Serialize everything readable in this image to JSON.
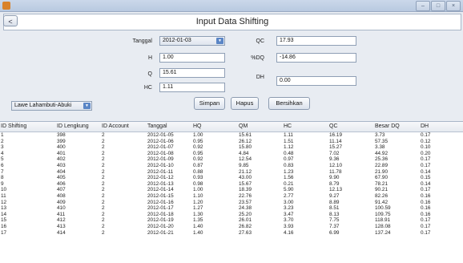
{
  "window": {
    "minimize": "–",
    "maximize": "□",
    "close": "×"
  },
  "header": {
    "back_label": "<",
    "title": "Input Data Shifting"
  },
  "form": {
    "tanggal_label": "Tanggal",
    "tanggal_value": "2012-01-03",
    "h_label": "H",
    "h_value": "1.00",
    "q_label": "Q",
    "q_value": "15.61",
    "hc_label": "HC",
    "hc_value": "1.11",
    "qc_label": "QC",
    "qc_value": "17.93",
    "dq_label": "%DQ",
    "dq_value": "-14.86",
    "dh_label": "DH",
    "dh_value": "0.00"
  },
  "station_select": {
    "value": "Lawe Lahambuti-Abuki"
  },
  "buttons": {
    "simpan": "Simpan",
    "hapus": "Hapus",
    "bersihkan": "Bersihkan"
  },
  "table": {
    "columns": [
      "ID Shifting",
      "ID Lengkung",
      "ID Account",
      "Tanggal",
      "HQ",
      "QM",
      "HC",
      "QC",
      "Besar DQ",
      "DH"
    ],
    "rows": [
      [
        "1",
        "398",
        "2",
        "2012-01-05",
        "1.00",
        "15.61",
        "1.11",
        "16.19",
        "3.73",
        "0.17"
      ],
      [
        "2",
        "399",
        "2",
        "2012-01-06",
        "0.95",
        "26.12",
        "1.51",
        "11.14",
        "57.35",
        "0.12"
      ],
      [
        "3",
        "400",
        "2",
        "2012-01-07",
        "0.92",
        "15.80",
        "1.12",
        "15.27",
        "3.38",
        "0.10"
      ],
      [
        "4",
        "401",
        "2",
        "2012-01-08",
        "0.95",
        "4.84",
        "0.48",
        "7.02",
        "44.92",
        "0.20"
      ],
      [
        "5",
        "402",
        "2",
        "2012-01-09",
        "0.92",
        "12.54",
        "0.97",
        "9.36",
        "25.36",
        "0.17"
      ],
      [
        "6",
        "403",
        "2",
        "2012-01-10",
        "0.87",
        "9.85",
        "0.83",
        "12.10",
        "22.89",
        "0.17"
      ],
      [
        "7",
        "404",
        "2",
        "2012-01-11",
        "0.88",
        "21.12",
        "1.23",
        "11.78",
        "21.90",
        "0.14"
      ],
      [
        "8",
        "405",
        "2",
        "2012-01-12",
        "0.93",
        "43.00",
        "1.56",
        "9.90",
        "67.90",
        "0.15"
      ],
      [
        "9",
        "406",
        "2",
        "2012-01-13",
        "0.98",
        "15.67",
        "0.21",
        "8.79",
        "78.21",
        "0.14"
      ],
      [
        "10",
        "407",
        "2",
        "2012-01-14",
        "1.00",
        "18.39",
        "5.90",
        "12.13",
        "90.21",
        "0.17"
      ],
      [
        "11",
        "408",
        "2",
        "2012-01-15",
        "1.10",
        "22.76",
        "2.77",
        "9.27",
        "82.26",
        "0.16"
      ],
      [
        "12",
        "409",
        "2",
        "2012-01-16",
        "1.20",
        "23.57",
        "3.00",
        "8.89",
        "91.42",
        "0.16"
      ],
      [
        "13",
        "410",
        "2",
        "2012-01-17",
        "1.27",
        "24.38",
        "3.23",
        "8.51",
        "100.59",
        "0.16"
      ],
      [
        "14",
        "411",
        "2",
        "2012-01-18",
        "1.30",
        "25.20",
        "3.47",
        "8.13",
        "109.75",
        "0.16"
      ],
      [
        "15",
        "412",
        "2",
        "2012-01-19",
        "1.35",
        "26.01",
        "3.70",
        "7.75",
        "118.91",
        "0.17"
      ],
      [
        "16",
        "413",
        "2",
        "2012-01-20",
        "1.40",
        "26.82",
        "3.93",
        "7.37",
        "128.08",
        "0.17"
      ],
      [
        "17",
        "414",
        "2",
        "2012-01-21",
        "1.40",
        "27.63",
        "4.16",
        "6.99",
        "137.24",
        "0.17"
      ]
    ]
  }
}
